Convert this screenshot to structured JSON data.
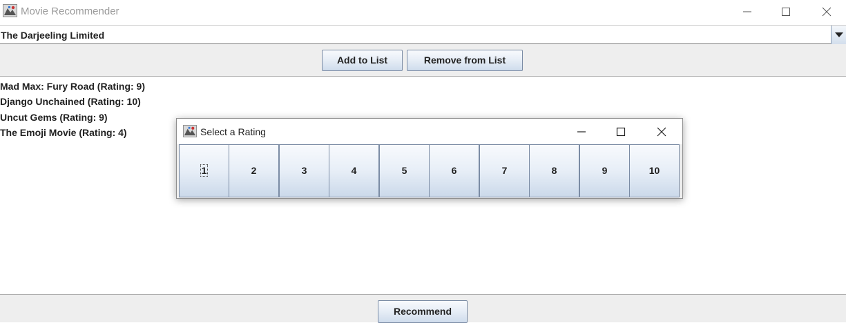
{
  "window": {
    "title": "Movie Recommender",
    "icon": "java-app-icon",
    "controls": [
      "minimize-icon",
      "maximize-icon",
      "close-icon"
    ]
  },
  "combo": {
    "selected": "The Darjeeling Limited",
    "arrow_icon": "chevron-down-icon"
  },
  "toolbar": {
    "add_label": "Add to List",
    "remove_label": "Remove from List"
  },
  "list": {
    "items": [
      "Mad Max: Fury Road (Rating: 9)",
      "Django Unchained (Rating: 10)",
      "Uncut Gems (Rating: 9)",
      "The Emoji Movie (Rating: 4)"
    ]
  },
  "bottom": {
    "recommend_label": "Recommend"
  },
  "dialog": {
    "title": "Select a Rating",
    "icon": "java-app-icon",
    "ratings": [
      "1",
      "2",
      "3",
      "4",
      "5",
      "6",
      "7",
      "8",
      "9",
      "10"
    ],
    "focused": "1"
  },
  "colors": {
    "button_border": "#7a8ba4",
    "button_gradient_top": "#f8fafd",
    "button_gradient_bottom": "#cfdcec",
    "panel_bg": "#eeeeee",
    "title_text": "#9a9a9a"
  }
}
